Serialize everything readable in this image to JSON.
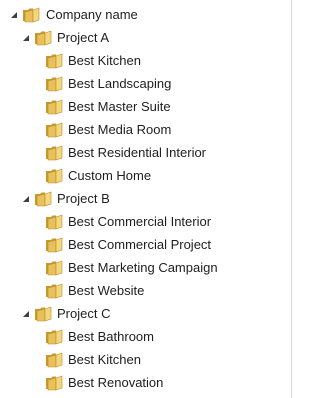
{
  "tree": {
    "root": {
      "label": "Company name",
      "expanded": true,
      "icon": "folder-icon",
      "children": [
        {
          "label": "Project A",
          "expanded": true,
          "icon": "folder-icon",
          "children": [
            "Best Kitchen",
            "Best Landscaping",
            "Best Master Suite",
            "Best Media Room",
            "Best Residential Interior",
            "Custom Home"
          ]
        },
        {
          "label": "Project B",
          "expanded": true,
          "icon": "folder-icon",
          "children": [
            "Best Commercial Interior",
            "Best Commercial Project",
            "Best Marketing Campaign",
            "Best Website"
          ]
        },
        {
          "label": "Project C",
          "expanded": true,
          "icon": "folder-icon",
          "children": [
            "Best Bathroom",
            "Best Kitchen",
            "Best Renovation"
          ]
        }
      ]
    },
    "colors": {
      "folder_front": "#e8c15a",
      "folder_back": "#c99a2e",
      "expander": "#404040",
      "text": "#1e1e1e"
    }
  }
}
